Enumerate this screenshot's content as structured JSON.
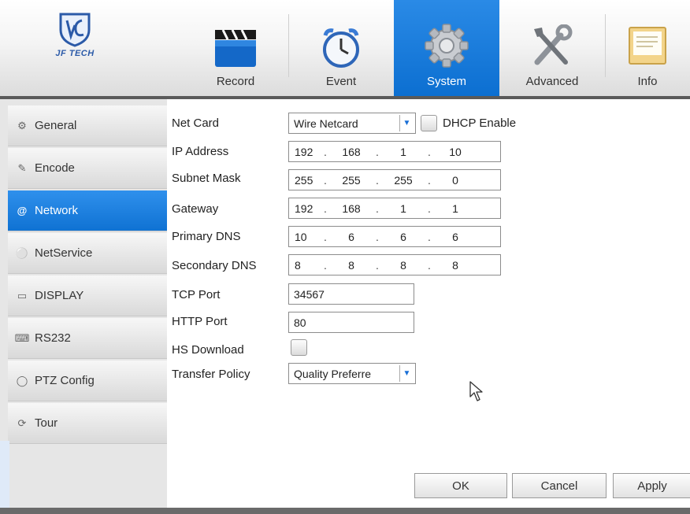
{
  "brand": {
    "logo_text": "JF TECH"
  },
  "tabs": [
    {
      "label": "Record",
      "icon": "clapperboard-icon"
    },
    {
      "label": "Event",
      "icon": "clock-icon"
    },
    {
      "label": "System",
      "icon": "gear-icon",
      "active": true
    },
    {
      "label": "Advanced",
      "icon": "tools-icon"
    },
    {
      "label": "Info",
      "icon": "document-icon"
    }
  ],
  "sidebar": {
    "items": [
      {
        "label": "General",
        "icon": "gear-small-icon"
      },
      {
        "label": "Encode",
        "icon": "edit-icon"
      },
      {
        "label": "Network",
        "icon": "at-icon",
        "active": true
      },
      {
        "label": "NetService",
        "icon": "globe-icon"
      },
      {
        "label": "DISPLAY",
        "icon": "monitor-icon"
      },
      {
        "label": "RS232",
        "icon": "keyboard-icon"
      },
      {
        "label": "PTZ Config",
        "icon": "ptz-icon"
      },
      {
        "label": "Tour",
        "icon": "refresh-icon"
      }
    ]
  },
  "network": {
    "net_card": {
      "label": "Net Card",
      "value": "Wire Netcard"
    },
    "dhcp": {
      "label": "DHCP Enable",
      "checked": false
    },
    "ip_address": {
      "label": "IP Address",
      "octets": [
        "192",
        "168",
        "1",
        "10"
      ]
    },
    "subnet_mask": {
      "label": "Subnet Mask",
      "octets": [
        "255",
        "255",
        "255",
        "0"
      ]
    },
    "gateway": {
      "label": "Gateway",
      "octets": [
        "192",
        "168",
        "1",
        "1"
      ]
    },
    "primary_dns": {
      "label": "Primary DNS",
      "octets": [
        "10",
        "6",
        "6",
        "6"
      ]
    },
    "secondary_dns": {
      "label": "Secondary DNS",
      "octets": [
        "8",
        "8",
        "8",
        "8"
      ]
    },
    "tcp_port": {
      "label": "TCP Port",
      "value": "34567"
    },
    "http_port": {
      "label": "HTTP Port",
      "value": "80"
    },
    "hs_download": {
      "label": "HS Download",
      "checked": false
    },
    "transfer_policy": {
      "label": "Transfer Policy",
      "value": "Quality Preferre"
    }
  },
  "buttons": {
    "ok": "OK",
    "cancel": "Cancel",
    "apply": "Apply"
  },
  "colors": {
    "accent": "#1479dc",
    "header_line": "#5a5a5a"
  }
}
